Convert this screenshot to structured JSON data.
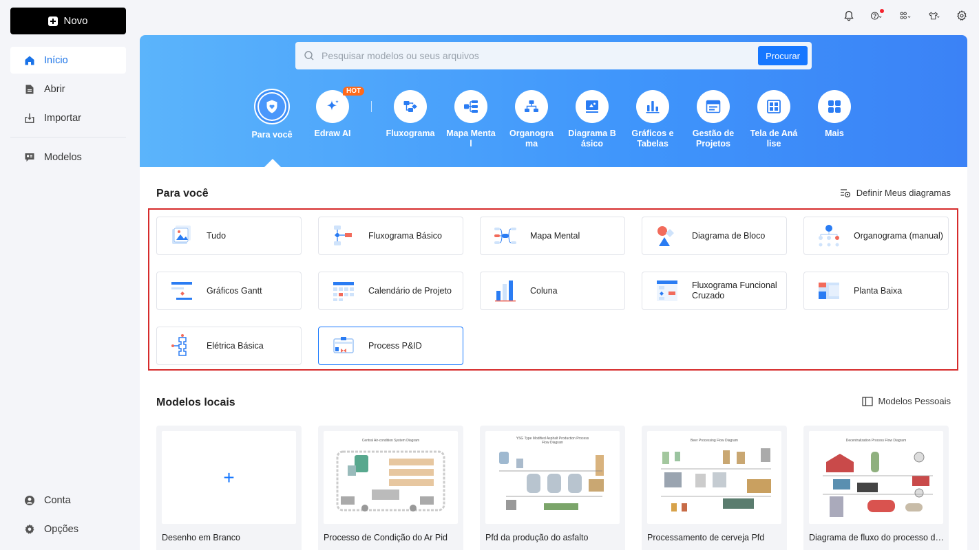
{
  "sidebar": {
    "new_label": "Novo",
    "items": [
      {
        "label": "Início"
      },
      {
        "label": "Abrir"
      },
      {
        "label": "Importar"
      },
      {
        "label": "Modelos"
      }
    ],
    "bottom": [
      {
        "label": "Conta"
      },
      {
        "label": "Opções"
      }
    ]
  },
  "search": {
    "placeholder": "Pesquisar modelos ou seus arquivos",
    "button": "Procurar"
  },
  "categories": [
    {
      "label": "Para você"
    },
    {
      "label": "Edraw AI",
      "badge": "HOT"
    },
    {
      "label": "Fluxograma"
    },
    {
      "label": "Mapa Mental"
    },
    {
      "label": "Organograma"
    },
    {
      "label": "Diagrama Básico"
    },
    {
      "label": "Gráficos e Tabelas"
    },
    {
      "label": "Gestão de Projetos"
    },
    {
      "label": "Tela de Análise"
    },
    {
      "label": "Mais"
    }
  ],
  "for_you": {
    "title": "Para você",
    "link": "Definir Meus diagramas",
    "templates": [
      {
        "name": "Tudo"
      },
      {
        "name": "Fluxograma Básico"
      },
      {
        "name": "Mapa Mental"
      },
      {
        "name": "Diagrama de Bloco"
      },
      {
        "name": "Organograma (manual)"
      },
      {
        "name": "Gráficos Gantt"
      },
      {
        "name": "Calendário de Projeto"
      },
      {
        "name": "Coluna"
      },
      {
        "name": "Fluxograma Funcional Cruzado"
      },
      {
        "name": "Planta Baixa"
      },
      {
        "name": "Elétrica Básica"
      },
      {
        "name": "Process P&ID"
      }
    ]
  },
  "local": {
    "title": "Modelos locais",
    "link": "Modelos Pessoais",
    "cards": [
      {
        "caption": "Desenho em Branco"
      },
      {
        "caption": "Processo de Condição do Ar Pid",
        "thumb_title": "Central Air-condition System Diagram"
      },
      {
        "caption": "Pfd da produção do asfalto",
        "thumb_title": "YSG Type Modified Asphalt Production Process Flow Diagram"
      },
      {
        "caption": "Processamento de cerveja Pfd",
        "thumb_title": "Beer Processing Flow Diagram"
      },
      {
        "caption": "Diagrama de fluxo do processo de ...",
        "thumb_title": "Decentralization Process Flow Diagram"
      }
    ]
  },
  "colors": {
    "accent": "#1677ff",
    "hot": "#ff6a1a",
    "highlight": "#d62b2b"
  }
}
